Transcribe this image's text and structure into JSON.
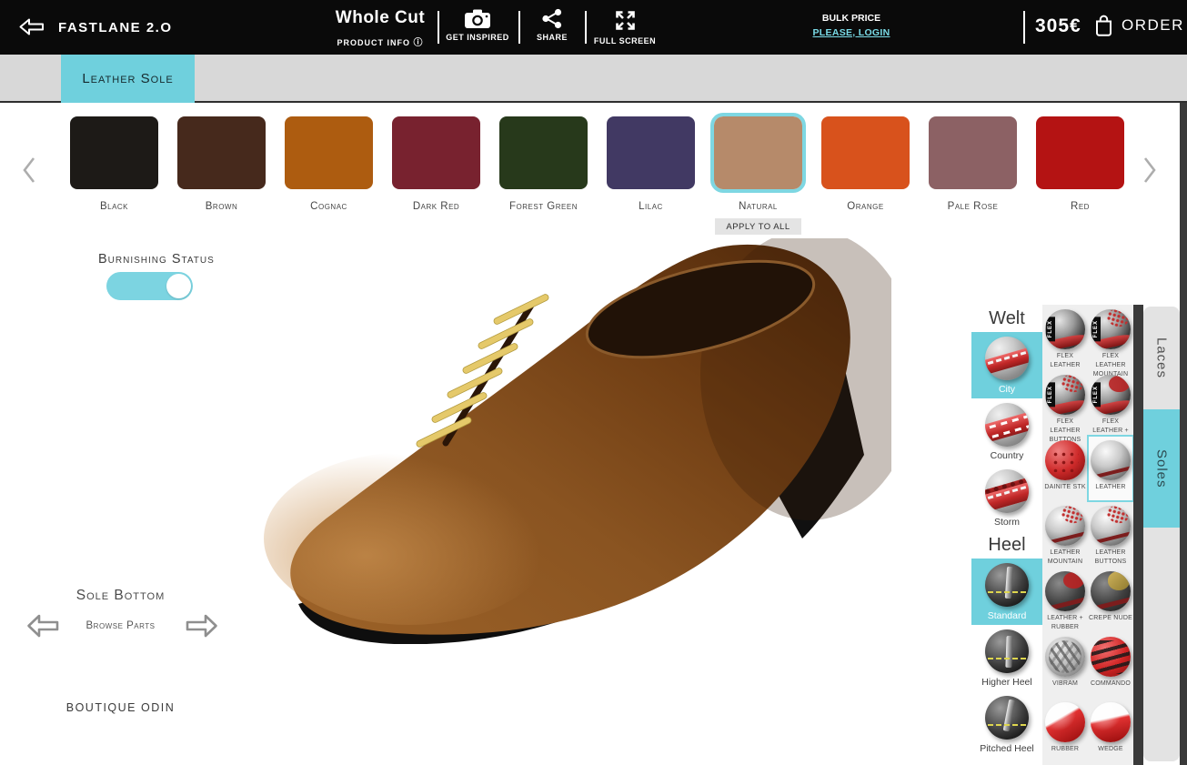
{
  "topbar": {
    "brand": "FASTLANE 2.O",
    "product_title": "Whole Cut",
    "product_info_label": "PRODUCT INFO",
    "get_inspired_label": "GET INSPIRED",
    "share_label": "SHARE",
    "full_screen_label": "FULL SCREEN",
    "bulk_price_label": "BULK PRICE",
    "login_link_label": "PLEASE, LOGIN",
    "price": "305€",
    "order_label": "ORDER",
    "icons": {
      "back": "outline-left-arrow",
      "product_info": "info-circle",
      "get_inspired": "camera",
      "share": "share-nodes",
      "full_screen": "expand-arrows",
      "order": "shopping-bag"
    }
  },
  "part_tabs": {
    "tabs": [
      {
        "label": "Leather Sole",
        "active": true
      }
    ]
  },
  "swatch_carousel": {
    "selected": "Natural",
    "apply_to_all_label": "APPLY TO ALL",
    "items": [
      {
        "label": "Black",
        "color": "#1d1a17"
      },
      {
        "label": "Brown",
        "color": "#46291c"
      },
      {
        "label": "Cognac",
        "color": "#ad5c10"
      },
      {
        "label": "Dark Red",
        "color": "#78222f"
      },
      {
        "label": "Forest Green",
        "color": "#27391b"
      },
      {
        "label": "Lilac",
        "color": "#413963"
      },
      {
        "label": "Natural",
        "color": "#b68a6a"
      },
      {
        "label": "Orange",
        "color": "#d8521c"
      },
      {
        "label": "Pale Rose",
        "color": "#8c6164"
      },
      {
        "label": "Red",
        "color": "#b41313"
      }
    ]
  },
  "burnishing": {
    "label": "Burnishing Status",
    "state": "on"
  },
  "sole_bottom": {
    "title": "Sole Bottom",
    "browse_label": "Browse Parts"
  },
  "boutique_label": "BOUTIQUE ODIN",
  "welt_panel": {
    "title": "Welt",
    "selected": "City",
    "items": [
      {
        "label": "City"
      },
      {
        "label": "Country"
      },
      {
        "label": "Storm"
      }
    ]
  },
  "heel_panel": {
    "title": "Heel",
    "selected": "Standard",
    "items": [
      {
        "label": "Standard"
      },
      {
        "label": "Higher Heel"
      },
      {
        "label": "Pitched Heel"
      }
    ]
  },
  "sole_grid": {
    "selected": "LEATHER",
    "flex_badge": "FLEX",
    "items": [
      {
        "label": "FLEX LEATHER"
      },
      {
        "label": "FLEX LEATHER MOUNTAIN"
      },
      {
        "label": "FLEX LEATHER BUTTONS"
      },
      {
        "label": "FLEX LEATHER + RUBBER"
      },
      {
        "label": "DAINITE STK"
      },
      {
        "label": "LEATHER"
      },
      {
        "label": "LEATHER MOUNTAIN"
      },
      {
        "label": "LEATHER BUTTONS"
      },
      {
        "label": "LEATHER + RUBBER"
      },
      {
        "label": "CREPE NUDE"
      },
      {
        "label": "VIBRAM"
      },
      {
        "label": "COMMANDO"
      },
      {
        "label": "RUBBER"
      },
      {
        "label": "WEDGE"
      }
    ]
  },
  "side_tabs": {
    "selected": "Soles",
    "items": [
      {
        "label": "Laces"
      },
      {
        "label": "Soles"
      }
    ]
  },
  "theme": {
    "accent": "#6fd0dd",
    "selection_border": "#7ed7e2",
    "link": "#7adce8",
    "topbar_bg": "#0a0a0a"
  }
}
